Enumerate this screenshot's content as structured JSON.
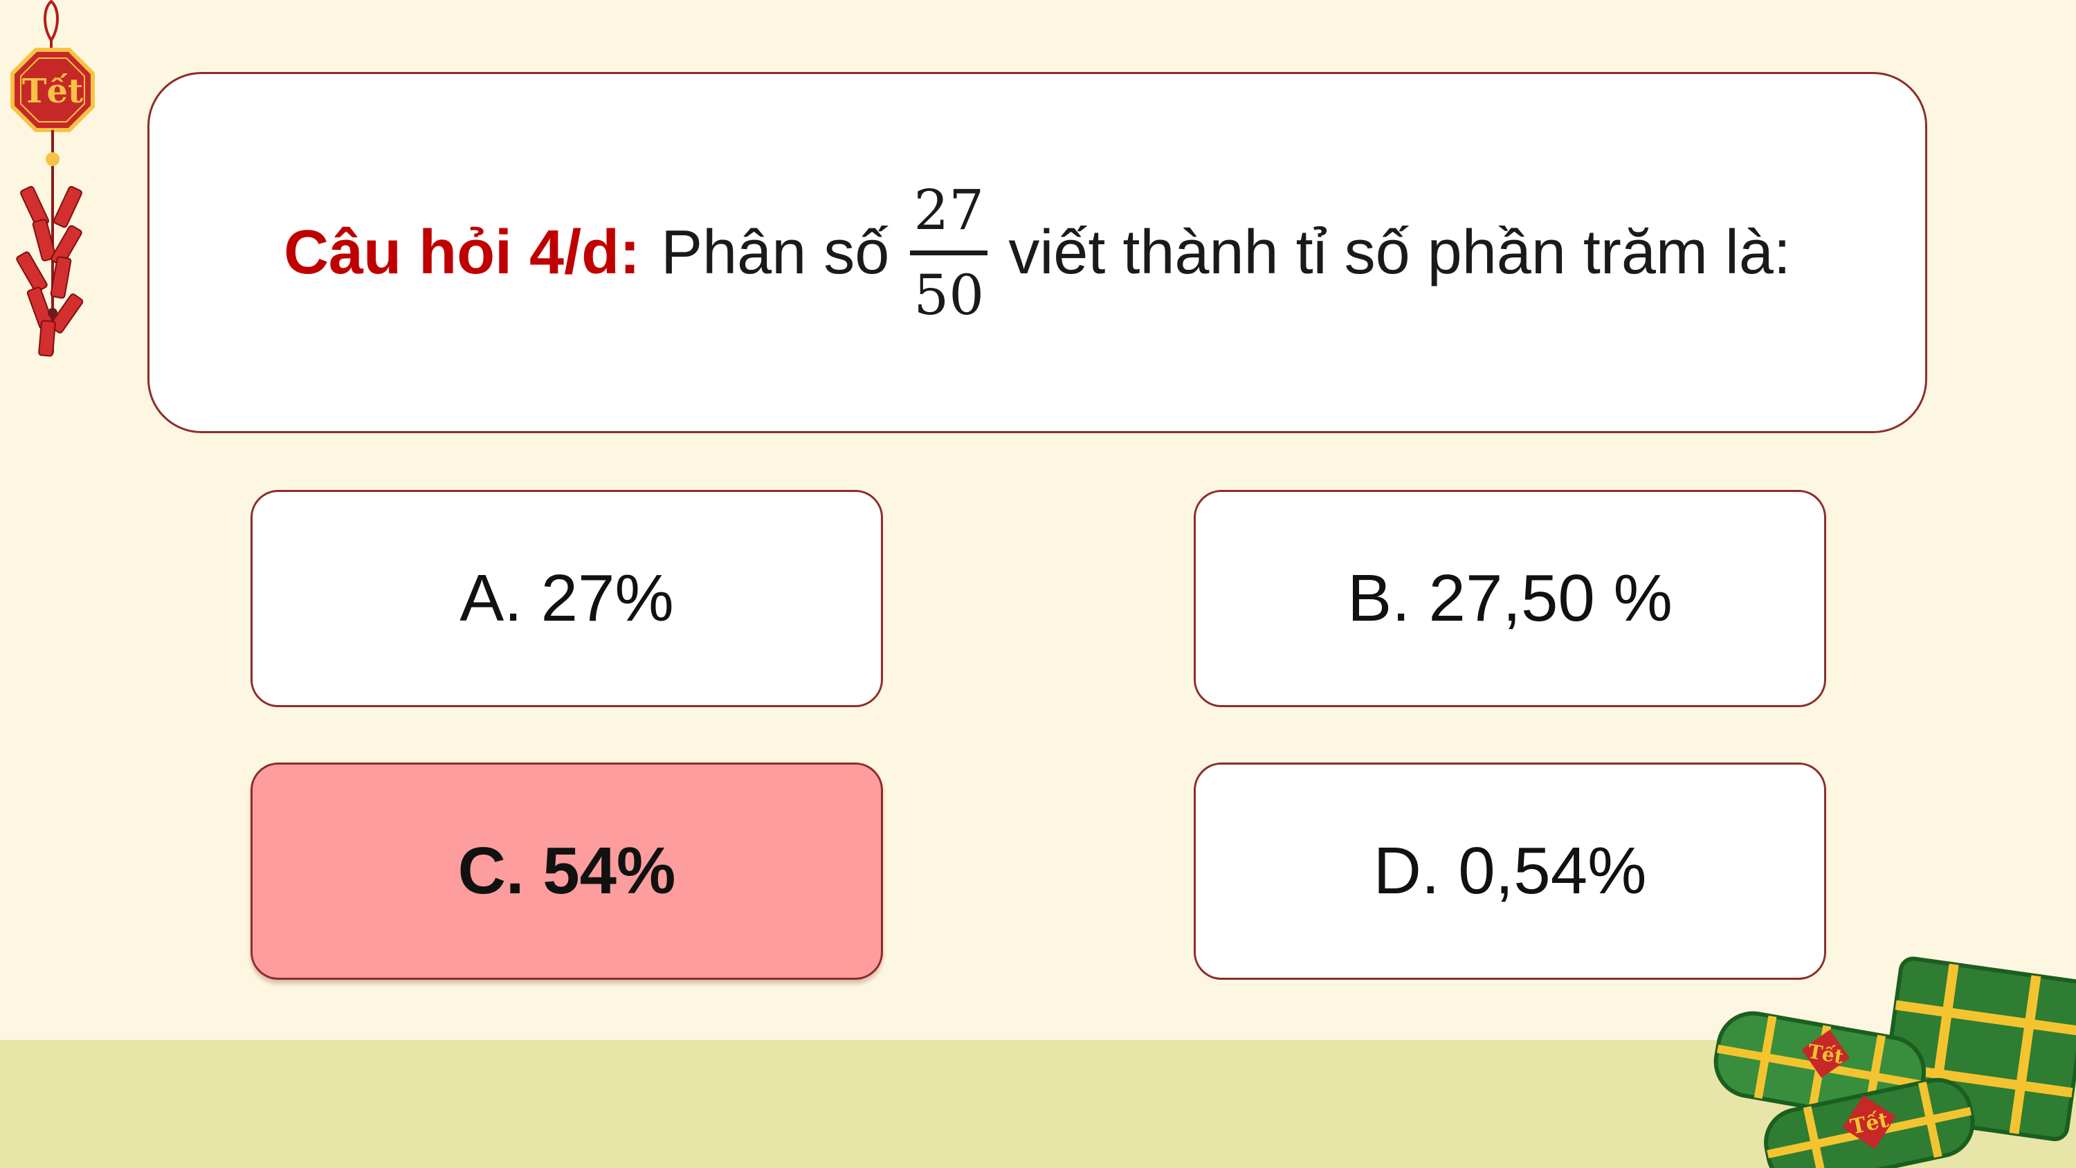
{
  "question": {
    "label": "Câu hỏi 4/d:",
    "text_before": "Phân số",
    "fraction": {
      "numerator": "27",
      "denominator": "50"
    },
    "text_after": "viết thành tỉ số phần trăm là:"
  },
  "answers": [
    {
      "text": "A. 27%",
      "selected": false
    },
    {
      "text": "B. 27,50 %",
      "selected": false
    },
    {
      "text": "C. 54%",
      "selected": true
    },
    {
      "text": "D. 0,54%",
      "selected": false
    }
  ],
  "decorations": {
    "ornament_text": "Tết",
    "cake_stamp_text": "Tết"
  },
  "colors": {
    "background": "#fdf7e1",
    "bottom_band": "#e8e5a9",
    "label_red": "#c00000",
    "border": "#8e2c2c",
    "selected_answer": "#fe9d9d"
  }
}
